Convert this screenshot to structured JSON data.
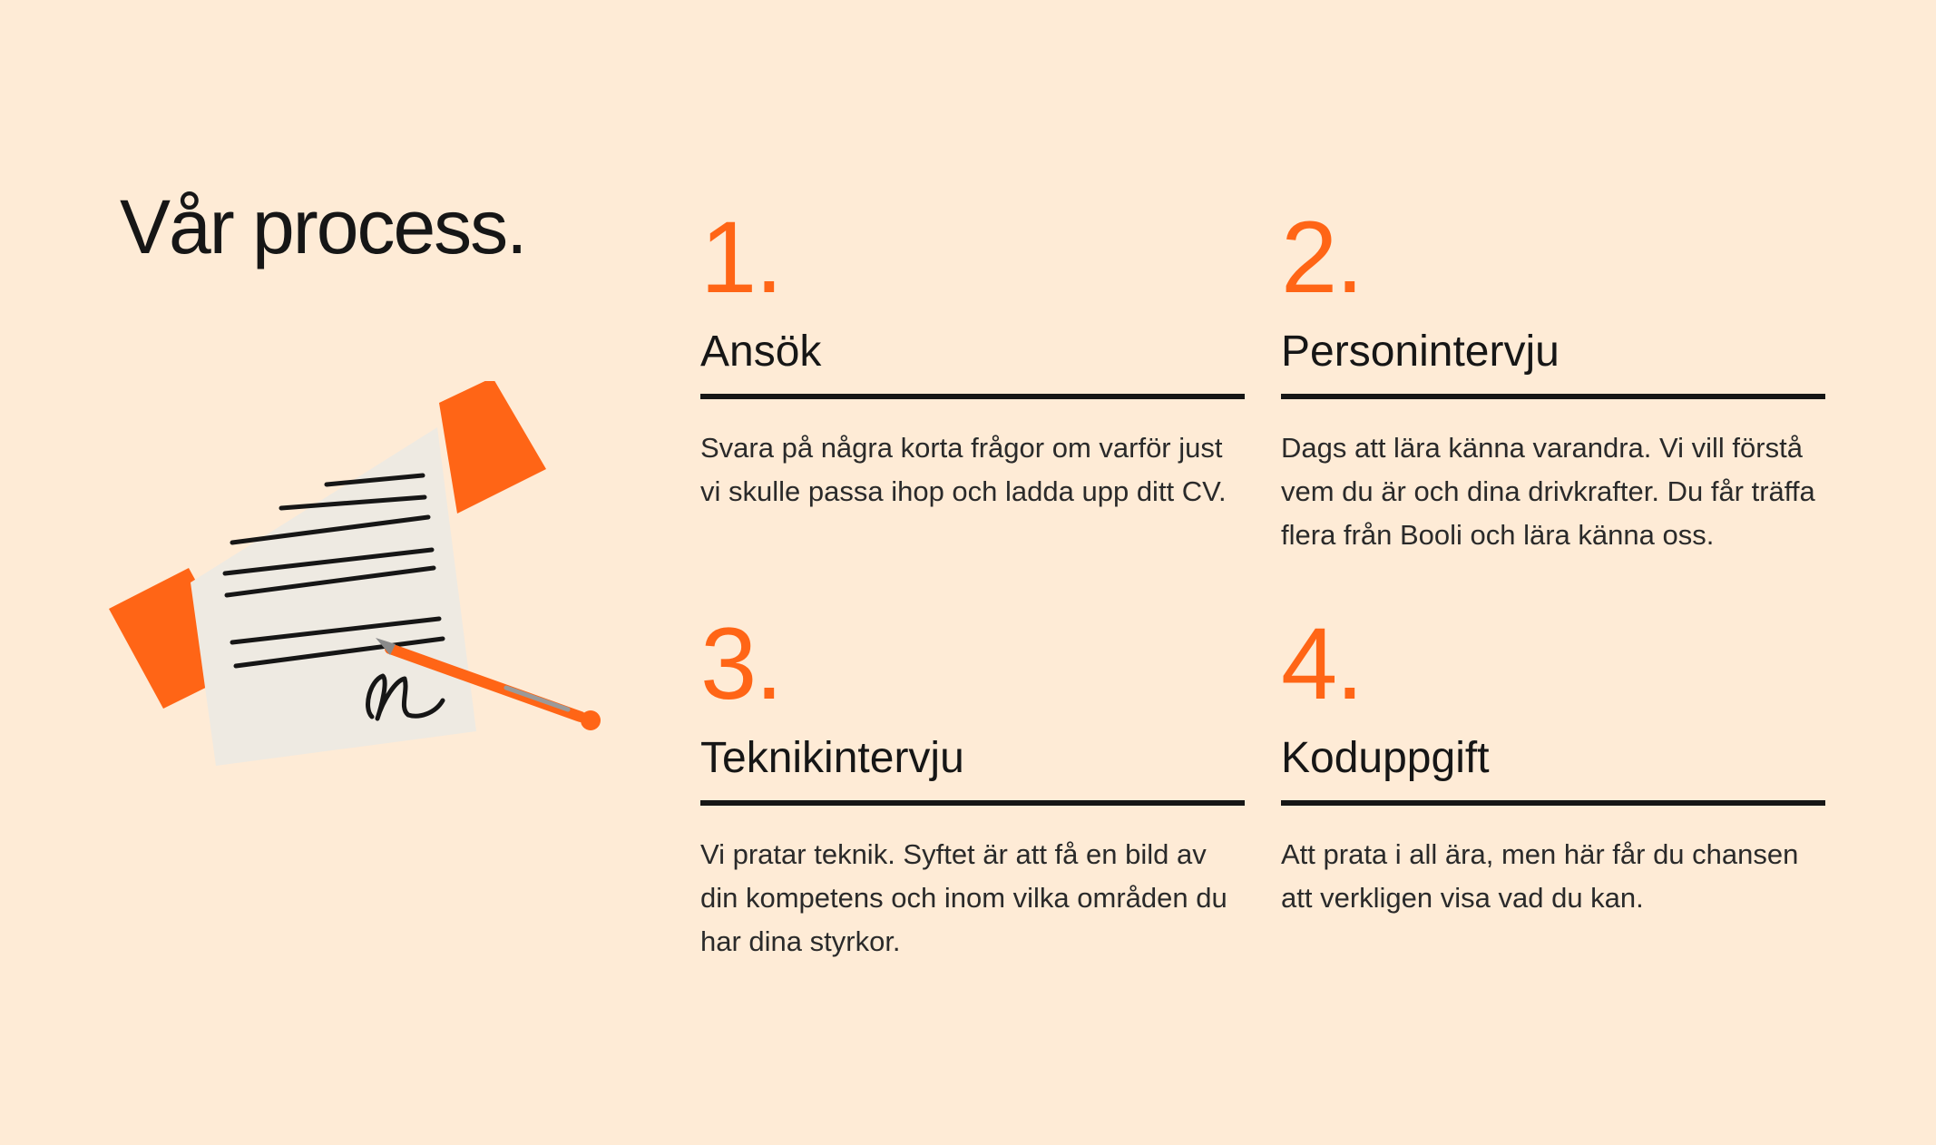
{
  "colors": {
    "background": "#FEEBD6",
    "accent": "#FF6516",
    "text": "#161616",
    "paper": "#EEEAE2"
  },
  "page": {
    "title": "Vår process."
  },
  "illustration": {
    "icon": "signed-document-with-tape-and-pen-icon"
  },
  "steps": [
    {
      "number": "1.",
      "title": "Ansök",
      "text": "Svara på några korta frågor om varför just vi skulle passa ihop och ladda upp ditt CV."
    },
    {
      "number": "2.",
      "title": "Personintervju",
      "text": "Dags att lära känna varandra. Vi vill förstå vem du är och dina drivkrafter. Du får träffa flera från Booli och lära känna oss."
    },
    {
      "number": "3.",
      "title": "Teknikintervju",
      "text": "Vi pratar teknik. Syftet är att få en bild av din kompetens och inom vilka områden du har dina styrkor."
    },
    {
      "number": "4.",
      "title": "Koduppgift",
      "text": "Att prata i all ära, men här får du chansen att verkligen visa vad du kan."
    }
  ]
}
